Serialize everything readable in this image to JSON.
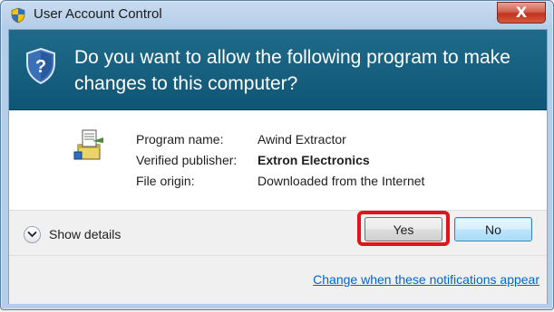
{
  "window": {
    "title": "User Account Control",
    "close_glyph": "X",
    "title_icon": "uac-shield-icon"
  },
  "banner": {
    "question": "Do you want to allow the following program to make changes to this computer?",
    "icon": "uac-shield-question-icon"
  },
  "program": {
    "icon": "installer-icon",
    "rows": [
      {
        "label": "Program name:",
        "value": "Awind Extractor",
        "bold": false
      },
      {
        "label": "Verified publisher:",
        "value": "Extron Electronics",
        "bold": true
      },
      {
        "label": "File origin:",
        "value": "Downloaded from the Internet",
        "bold": false
      }
    ]
  },
  "footer": {
    "show_details_label": "Show details",
    "yes_label": "Yes",
    "no_label": "No",
    "notifications_link": "Change when these notifications appear"
  },
  "colors": {
    "banner": "#1f6a8a",
    "highlight": "#e2141b",
    "link": "#0066cc"
  }
}
